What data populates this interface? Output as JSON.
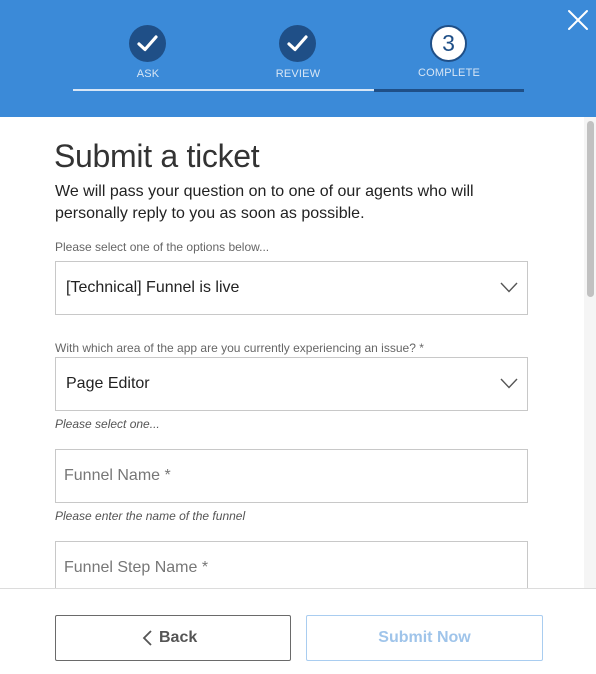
{
  "wizard": {
    "steps": [
      {
        "label": "ASK",
        "state": "done"
      },
      {
        "label": "REVIEW",
        "state": "done"
      },
      {
        "label": "COMPLETE",
        "state": "current",
        "number": "3"
      }
    ]
  },
  "form": {
    "title": "Submit a ticket",
    "intro": "We will pass your question on to one of our agents who will personally reply to you as soon as possible.",
    "option_label": "Please select one of the options below...",
    "option_value": "[Technical] Funnel is live",
    "area_label": "With which area of the app are you currently experiencing an issue? *",
    "area_value": "Page Editor",
    "area_help": "Please select one...",
    "funnel_name_placeholder": "Funnel Name *",
    "funnel_name_help": "Please enter the name of the funnel",
    "funnel_step_placeholder": "Funnel Step Name *"
  },
  "footer": {
    "back_label": "Back",
    "submit_label": "Submit Now"
  },
  "colors": {
    "header": "#3b8ad8",
    "step_done": "#1f4f87",
    "submit_disabled": "#9fc4ea"
  }
}
